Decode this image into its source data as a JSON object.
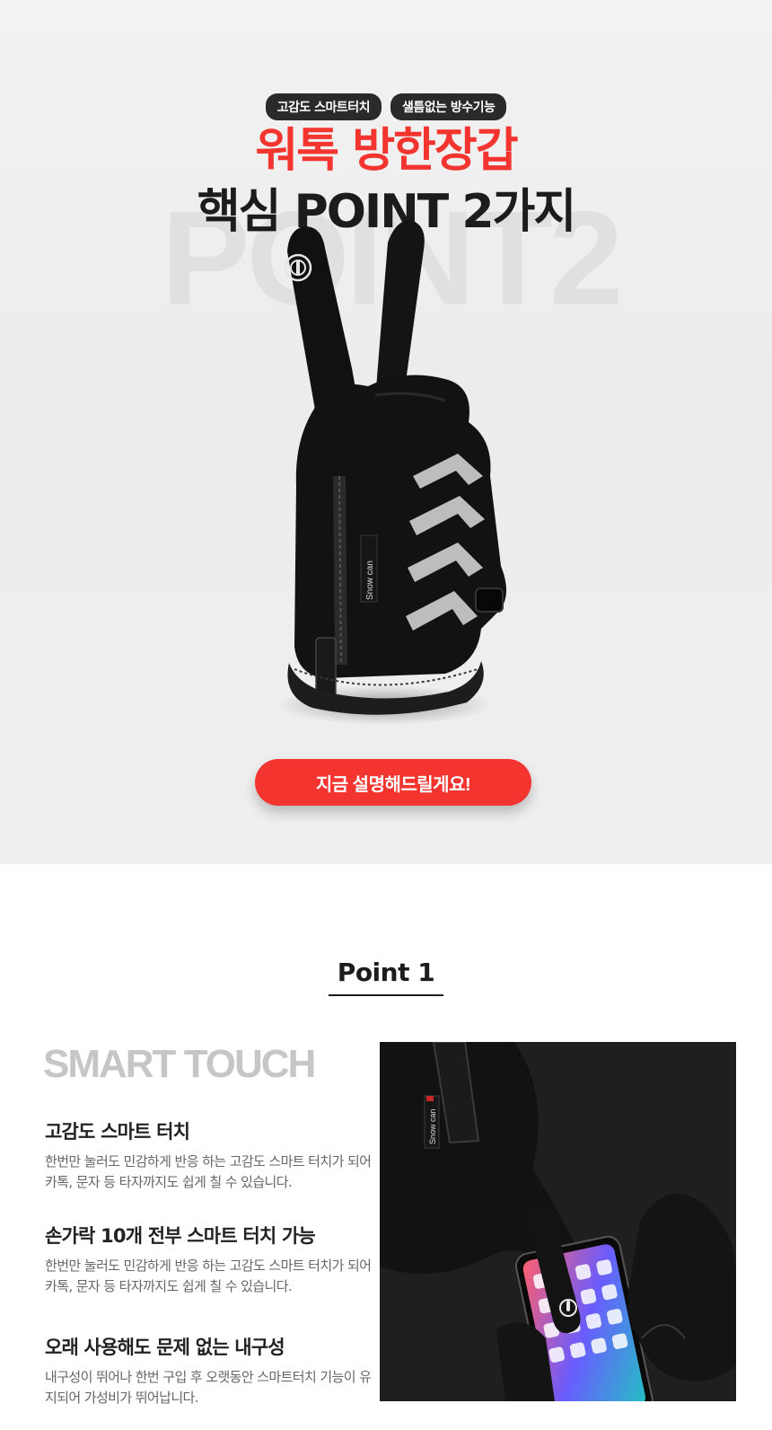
{
  "hero": {
    "badges": [
      "고감도 스마트터치",
      "샐틈없는 방수기능"
    ],
    "title_line1": "워톡 방한장갑",
    "title_line2": "핵심 POINT 2가지",
    "background_word": "POINT2",
    "glove_brand": "Snow can",
    "cta_label": "지금 설명해드릴게요!"
  },
  "point1": {
    "heading": "Point 1",
    "section_title": "SMART TOUCH",
    "features": [
      {
        "title": "고감도 스마트 터치",
        "body": "한번만 눌러도 민감하게 반응 하는 고감도 스마트 터치가 되어 카톡, 문자 등 타자까지도 쉽게 칠 수 있습니다."
      },
      {
        "title": "손가락 10개 전부 스마트 터치 가능",
        "body": "한번만 눌러도 민감하게 반응 하는 고감도 스마트 터치가 되어 카톡, 문자 등 타자까지도 쉽게 칠 수 있습니다."
      },
      {
        "title": "오래 사용해도 문제 없는 내구성",
        "body": "내구성이 뛰어나 한번 구입 후 오랫동안 스마트터치 기능이 유지되어 가성비가 뛰어납니다."
      }
    ],
    "photo_brand": "Snow can"
  },
  "colors": {
    "accent_red": "#f3342f",
    "dark": "#1c1c1c",
    "badge_bg": "#2a2a2a"
  },
  "icons": [
    "touch-icon",
    "chevron-reflector-icon",
    "zipper-icon"
  ]
}
